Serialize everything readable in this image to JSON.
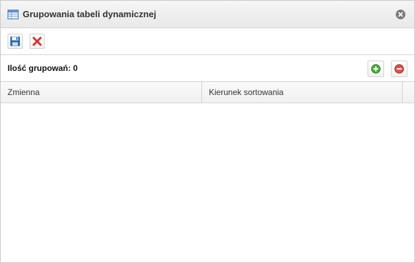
{
  "dialog": {
    "title": "Grupowania tabeli dynamicznej"
  },
  "toolbar": {
    "save_icon": "floppy-disk-icon",
    "delete_icon": "red-x-icon"
  },
  "groupings": {
    "count_label": "Ilość grupowań: 0",
    "add_icon": "green-plus-circle-icon",
    "remove_icon": "red-minus-circle-icon"
  },
  "grid": {
    "columns": [
      "Zmienna",
      "Kierunek sortowania"
    ],
    "rows": []
  },
  "colors": {
    "accent_blue": "#2b6cb0",
    "delete_red": "#d9302c",
    "add_green": "#4caf3a"
  }
}
